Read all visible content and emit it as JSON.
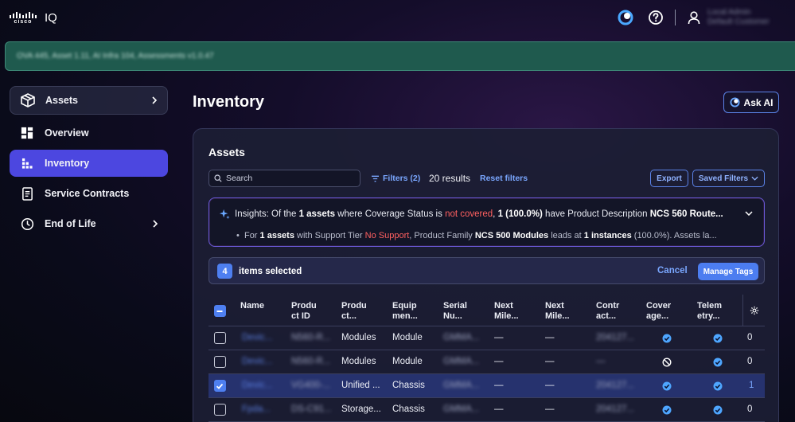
{
  "app": {
    "brand": "cisco",
    "product": "IQ"
  },
  "user": {
    "name": "Local Admin",
    "org": "Default Customer"
  },
  "banner": {
    "text": "OVA 445, Asset 1.11, AI Infra 104, Assessments v1.0.47"
  },
  "nav": {
    "items": [
      {
        "label": "Assets",
        "icon": "box-icon"
      },
      {
        "label": "Overview",
        "icon": "dashboard-icon"
      },
      {
        "label": "Inventory",
        "icon": "grid-icon"
      },
      {
        "label": "Service Contracts",
        "icon": "document-icon"
      },
      {
        "label": "End of Life",
        "icon": "clock-icon"
      }
    ]
  },
  "page": {
    "title": "Inventory",
    "ask_ai": "Ask AI"
  },
  "panel": {
    "title": "Assets",
    "search_placeholder": "Search",
    "filters_label": "Filters (2)",
    "results": "20 results",
    "reset_label": "Reset filters",
    "export_label": "Export",
    "saved_filters_label": "Saved Filters"
  },
  "insights": {
    "prefix": "Insights:",
    "l1_a": "Of the",
    "l1_b": "1 assets",
    "l1_c": "where Coverage Status is",
    "l1_d": "not covered",
    "l1_e": ",",
    "l1_f": "1 (100.0%)",
    "l1_g": "have Product Description",
    "l1_h": "NCS 560 Route...",
    "l2_a": "For",
    "l2_b": "1 assets",
    "l2_c": "with Support Tier",
    "l2_d": "No Support",
    "l2_e": ", Product Family",
    "l2_f": "NCS 500 Modules",
    "l2_g": "leads at",
    "l2_h": "1 instances",
    "l2_i": "(100.0%). Assets la..."
  },
  "selection": {
    "count": "4",
    "text": "items selected",
    "cancel": "Cancel",
    "manage": "Manage Tags"
  },
  "table": {
    "columns": [
      {
        "l1": "Name",
        "l2": ""
      },
      {
        "l1": "Produ",
        "l2": "ct ID"
      },
      {
        "l1": "Produ",
        "l2": "ct..."
      },
      {
        "l1": "Equip",
        "l2": "men..."
      },
      {
        "l1": "Serial",
        "l2": "Nu..."
      },
      {
        "l1": "Next",
        "l2": "Mile..."
      },
      {
        "l1": "Next",
        "l2": "Mile..."
      },
      {
        "l1": "Contr",
        "l2": "act..."
      },
      {
        "l1": "Cover",
        "l2": "age..."
      },
      {
        "l1": "Telem",
        "l2": "etry..."
      }
    ],
    "rows": [
      {
        "name": "Devic...",
        "pid": "N560-R...",
        "product": "Modules",
        "equip": "Module",
        "serial": "GMMA...",
        "m1": "—",
        "m2": "—",
        "contract": "204127...",
        "coverage": "covered",
        "telemetry": "check",
        "count": "0",
        "selected": false
      },
      {
        "name": "Devic...",
        "pid": "N560-R...",
        "product": "Modules",
        "equip": "Module",
        "serial": "GMMA...",
        "m1": "—",
        "m2": "—",
        "contract": "—",
        "coverage": "not-covered",
        "telemetry": "check",
        "count": "0",
        "selected": false
      },
      {
        "name": "Devic...",
        "pid": "VG400-...",
        "product": "Unified ...",
        "equip": "Chassis",
        "serial": "GMMA...",
        "m1": "—",
        "m2": "—",
        "contract": "204127...",
        "coverage": "covered",
        "telemetry": "check",
        "count": "1",
        "selected": true
      },
      {
        "name": "Fpda...",
        "pid": "DS-C91...",
        "product": "Storage...",
        "equip": "Chassis",
        "serial": "GMMA...",
        "m1": "—",
        "m2": "—",
        "contract": "204127...",
        "coverage": "covered",
        "telemetry": "check",
        "count": "0",
        "selected": false
      }
    ]
  },
  "colors": {
    "accent": "#4c47e0",
    "link": "#7aa7ff",
    "danger": "#ff6060",
    "banner": "#1f5a4e"
  }
}
